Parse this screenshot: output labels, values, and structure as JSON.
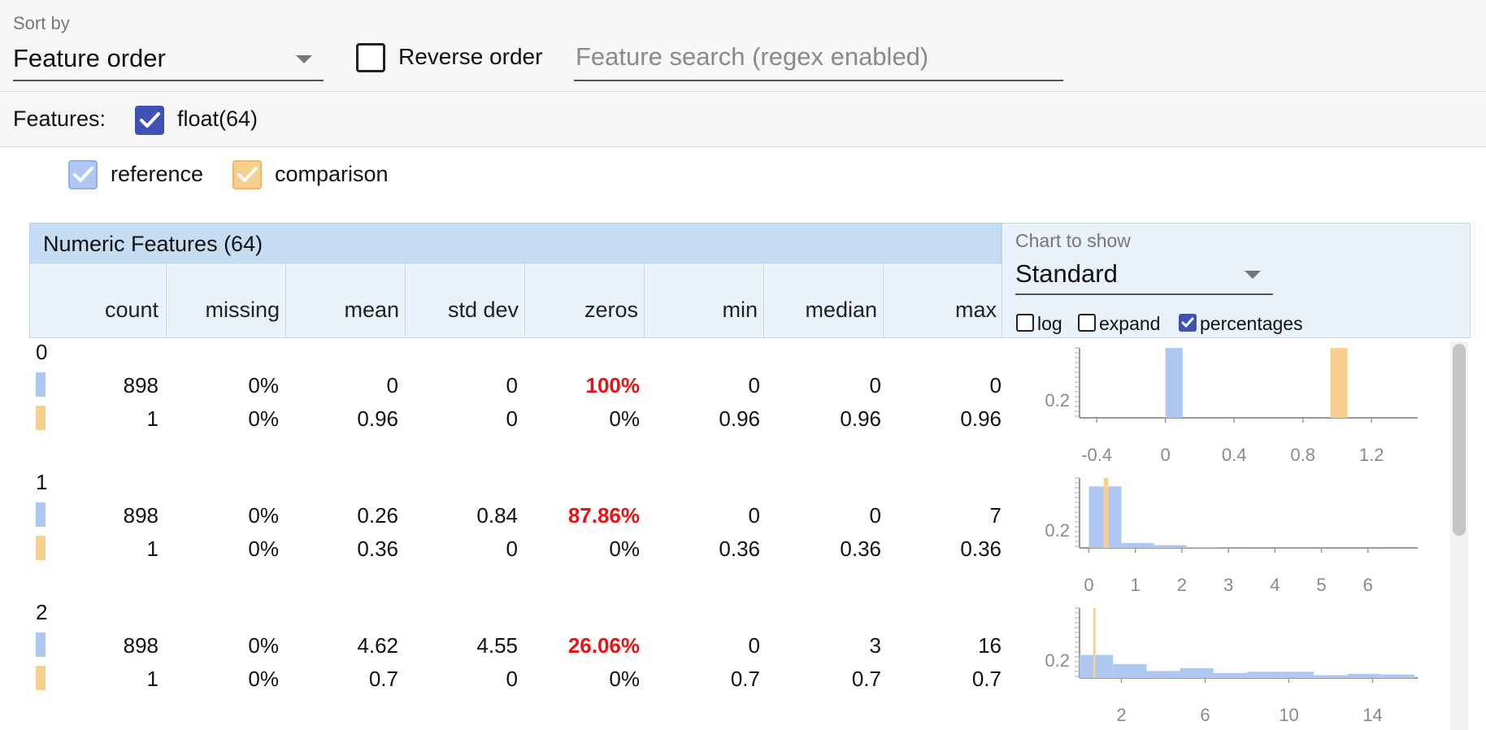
{
  "toolbar": {
    "sort_label": "Sort by",
    "sort_value": "Feature order",
    "reverse_label": "Reverse order",
    "reverse_checked": false,
    "search_placeholder": "Feature search (regex enabled)",
    "search_value": ""
  },
  "features_row": {
    "label": "Features:",
    "type_label": "float(64)",
    "type_checked": true
  },
  "legend": {
    "reference_label": "reference",
    "comparison_label": "comparison",
    "reference_color": "#aec8f2",
    "comparison_color": "#f7cf8e"
  },
  "table": {
    "title": "Numeric Features (64)",
    "columns": [
      "count",
      "missing",
      "mean",
      "std dev",
      "zeros",
      "min",
      "median",
      "max"
    ],
    "rows": [
      {
        "name": "0",
        "reference": [
          "898",
          "0%",
          "0",
          "0",
          "100%",
          "0",
          "0",
          "0"
        ],
        "comparison": [
          "1",
          "0%",
          "0.96",
          "0",
          "0%",
          "0.96",
          "0.96",
          "0.96"
        ]
      },
      {
        "name": "1",
        "reference": [
          "898",
          "0%",
          "0.26",
          "0.84",
          "87.86%",
          "0",
          "0",
          "7"
        ],
        "comparison": [
          "1",
          "0%",
          "0.36",
          "0",
          "0%",
          "0.36",
          "0.36",
          "0.36"
        ]
      },
      {
        "name": "2",
        "reference": [
          "898",
          "0%",
          "4.62",
          "4.55",
          "26.06%",
          "0",
          "3",
          "16"
        ],
        "comparison": [
          "1",
          "0%",
          "0.7",
          "0",
          "0%",
          "0.7",
          "0.7",
          "0.7"
        ]
      }
    ]
  },
  "chart_controls": {
    "label": "Chart to show",
    "value": "Standard",
    "log_label": "log",
    "log_checked": false,
    "expand_label": "expand",
    "expand_checked": false,
    "percentages_label": "percentages",
    "percentages_checked": true,
    "accent_color": "#3f51b5",
    "highlight_color": "#ee1111"
  },
  "chart_data": [
    {
      "type": "bar",
      "feature": "0",
      "ytick_labels": [
        "0.2"
      ],
      "xtick_labels": [
        "-0.4",
        "0",
        "0.4",
        "0.8",
        "1.2"
      ],
      "xlim": [
        -0.5,
        1.45
      ],
      "ylim": [
        0,
        1
      ],
      "series": [
        {
          "color": "#aec8f2",
          "bins": [
            {
              "x0": 0.0,
              "x1": 0.1,
              "y": 1.0
            }
          ]
        },
        {
          "color": "#f7cf8e",
          "bins": [
            {
              "x0": 0.96,
              "x1": 1.06,
              "y": 1.0
            }
          ]
        }
      ]
    },
    {
      "type": "bar",
      "feature": "1",
      "ytick_labels": [
        "0.2"
      ],
      "xtick_labels": [
        "0",
        "1",
        "2",
        "3",
        "4",
        "5",
        "6"
      ],
      "xlim": [
        -0.2,
        7.0
      ],
      "ylim": [
        0,
        1
      ],
      "series": [
        {
          "color": "#aec8f2",
          "bins": [
            {
              "x0": 0.0,
              "x1": 0.7,
              "y": 0.88
            },
            {
              "x0": 0.7,
              "x1": 1.4,
              "y": 0.07
            },
            {
              "x0": 1.4,
              "x1": 2.1,
              "y": 0.04
            },
            {
              "x0": 2.1,
              "x1": 2.8,
              "y": 0.01
            },
            {
              "x0": 2.8,
              "x1": 3.5,
              "y": 0.005
            },
            {
              "x0": 3.5,
              "x1": 4.2,
              "y": 0.004
            },
            {
              "x0": 4.2,
              "x1": 4.9,
              "y": 0.003
            },
            {
              "x0": 4.9,
              "x1": 5.6,
              "y": 0.002
            },
            {
              "x0": 5.6,
              "x1": 6.3,
              "y": 0.002
            },
            {
              "x0": 6.3,
              "x1": 7.0,
              "y": 0.001
            }
          ]
        },
        {
          "color": "#f7cf8e",
          "bins": [
            {
              "x0": 0.32,
              "x1": 0.42,
              "y": 1.0
            }
          ]
        }
      ]
    },
    {
      "type": "bar",
      "feature": "2",
      "ytick_labels": [
        "0.2"
      ],
      "xtick_labels": [
        "2",
        "6",
        "10",
        "14"
      ],
      "xlim": [
        0,
        16
      ],
      "ylim": [
        0,
        1
      ],
      "series": [
        {
          "color": "#aec8f2",
          "bins": [
            {
              "x0": 0.0,
              "x1": 1.6,
              "y": 0.33
            },
            {
              "x0": 1.6,
              "x1": 3.2,
              "y": 0.2
            },
            {
              "x0": 3.2,
              "x1": 4.8,
              "y": 0.1
            },
            {
              "x0": 4.8,
              "x1": 6.4,
              "y": 0.14
            },
            {
              "x0": 6.4,
              "x1": 8.0,
              "y": 0.07
            },
            {
              "x0": 8.0,
              "x1": 9.6,
              "y": 0.09
            },
            {
              "x0": 9.6,
              "x1": 11.2,
              "y": 0.09
            },
            {
              "x0": 11.2,
              "x1": 12.8,
              "y": 0.04
            },
            {
              "x0": 12.8,
              "x1": 14.4,
              "y": 0.06
            },
            {
              "x0": 14.4,
              "x1": 16.0,
              "y": 0.05
            }
          ]
        },
        {
          "color": "#f7cf8e",
          "bins": [
            {
              "x0": 0.65,
              "x1": 0.75,
              "y": 1.0
            }
          ]
        }
      ]
    }
  ]
}
